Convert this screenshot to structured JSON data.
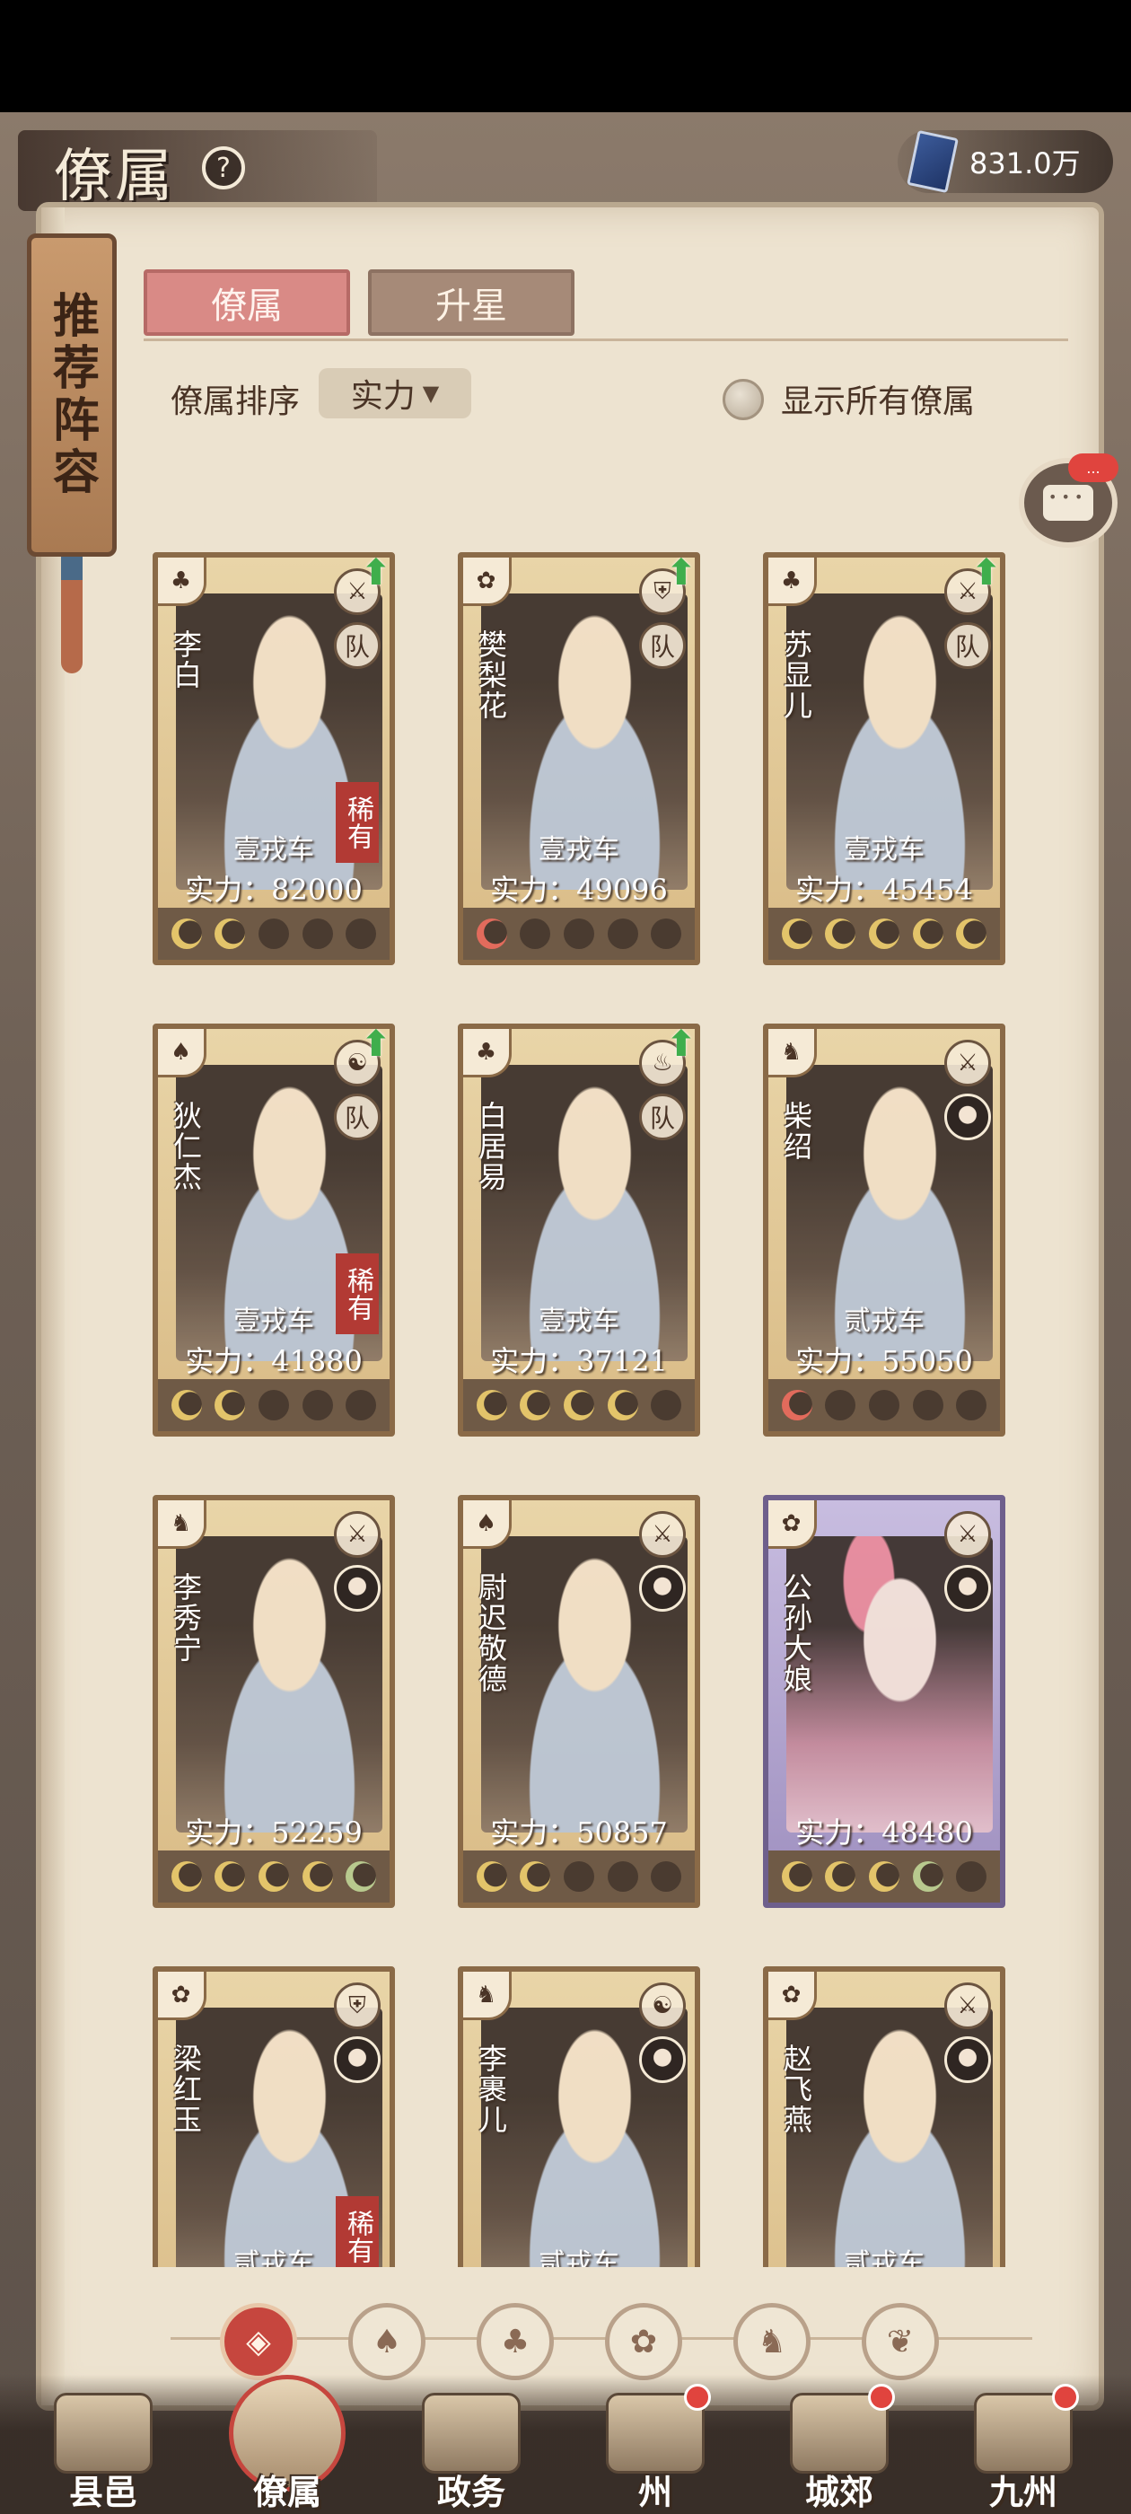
{
  "header": {
    "title": "僚属",
    "help_icon": "question-icon",
    "currency": {
      "icon": "book-token-icon",
      "value": "831.0万"
    }
  },
  "sidebar": {
    "recommend_label": "推荐阵容"
  },
  "tabs": [
    {
      "label": "僚属",
      "active": true
    },
    {
      "label": "升星",
      "active": false
    }
  ],
  "sort": {
    "label": "僚属排序",
    "selected": "实力",
    "show_all_label": "显示所有僚属",
    "show_all_checked": false
  },
  "chat": {
    "icon": "chat-icon",
    "badge": "..."
  },
  "cards": [
    {
      "name": "李白",
      "type_icon": "♣",
      "weapon": "⚔",
      "team": "队",
      "rare": "稀有",
      "rank": "壹戎车",
      "power": "实力：82000",
      "stars": [
        "gold",
        "gold",
        "empty",
        "empty",
        "empty"
      ],
      "upgradable": true
    },
    {
      "name": "樊梨花",
      "type_icon": "✿",
      "weapon": "⛨",
      "team": "队",
      "rare": "",
      "rank": "壹戎车",
      "power": "实力：49096",
      "stars": [
        "red",
        "empty",
        "empty",
        "empty",
        "empty"
      ],
      "upgradable": true
    },
    {
      "name": "苏显儿",
      "type_icon": "♣",
      "weapon": "⚔",
      "team": "队",
      "rare": "",
      "rank": "壹戎车",
      "power": "实力：45454",
      "stars": [
        "gold",
        "gold",
        "gold",
        "gold",
        "gold"
      ],
      "upgradable": true
    },
    {
      "name": "狄仁杰",
      "type_icon": "♠",
      "weapon": "☯",
      "team": "队",
      "rare": "稀有",
      "rank": "壹戎车",
      "power": "实力：41880",
      "stars": [
        "gold",
        "gold",
        "empty",
        "empty",
        "empty"
      ],
      "upgradable": true
    },
    {
      "name": "白居易",
      "type_icon": "♣",
      "weapon": "♨",
      "team": "队",
      "rare": "",
      "rank": "壹戎车",
      "power": "实力：37121",
      "stars": [
        "gold",
        "gold",
        "gold",
        "gold",
        "empty"
      ],
      "upgradable": true
    },
    {
      "name": "柴绍",
      "type_icon": "♞",
      "weapon": "⚔",
      "team": "",
      "rare": "",
      "rank": "贰戎车",
      "power": "实力：55050",
      "stars": [
        "red",
        "empty",
        "empty",
        "empty",
        "empty"
      ],
      "upgradable": false
    },
    {
      "name": "李秀宁",
      "type_icon": "♞",
      "weapon": "⚔",
      "team": "",
      "rare": "",
      "rank": "",
      "power": "实力：52259",
      "stars": [
        "gold",
        "gold",
        "gold",
        "gold",
        "green"
      ],
      "upgradable": false
    },
    {
      "name": "尉迟敬德",
      "type_icon": "♠",
      "weapon": "⚔",
      "team": "",
      "rare": "",
      "rank": "",
      "power": "实力：50857",
      "stars": [
        "gold",
        "gold",
        "empty",
        "empty",
        "empty"
      ],
      "upgradable": false
    },
    {
      "name": "公孙大娘",
      "type_icon": "✿",
      "weapon": "⚔",
      "team": "",
      "rare": "",
      "rank": "",
      "power": "实力：48480",
      "stars": [
        "gold",
        "gold",
        "gold",
        "green",
        "empty"
      ],
      "upgradable": false,
      "epic": true
    },
    {
      "name": "梁红玉",
      "type_icon": "✿",
      "weapon": "⛨",
      "team": "",
      "rare": "稀有",
      "rank": "贰戎车",
      "power": "",
      "stars": [],
      "upgradable": false
    },
    {
      "name": "李裹儿",
      "type_icon": "♞",
      "weapon": "☯",
      "team": "",
      "rare": "",
      "rank": "贰戎车",
      "power": "",
      "stars": [],
      "upgradable": false
    },
    {
      "name": "赵飞燕",
      "type_icon": "✿",
      "weapon": "⚔",
      "team": "",
      "rare": "",
      "rank": "贰戎车",
      "power": "",
      "stars": [],
      "upgradable": false
    }
  ],
  "filters": [
    {
      "icon": "all-filter-icon",
      "glyph": "◈",
      "active": true
    },
    {
      "icon": "helmet-filter-icon",
      "glyph": "♠",
      "active": false
    },
    {
      "icon": "gourd-filter-icon",
      "glyph": "♣",
      "active": false
    },
    {
      "icon": "fan-filter-icon",
      "glyph": "✿",
      "active": false
    },
    {
      "icon": "horse-filter-icon",
      "glyph": "♞",
      "active": false
    },
    {
      "icon": "leaf-filter-icon",
      "glyph": "❦",
      "active": false
    }
  ],
  "bottom_nav": [
    {
      "label": "县邑",
      "icon": "county-icon",
      "active": false,
      "dot": false
    },
    {
      "label": "僚属",
      "icon": "subordinates-icon",
      "active": true,
      "dot": false
    },
    {
      "label": "政务",
      "icon": "affairs-icon",
      "active": false,
      "dot": false
    },
    {
      "label": "州",
      "icon": "prefecture-icon",
      "active": false,
      "dot": true
    },
    {
      "label": "城郊",
      "icon": "suburbs-icon",
      "active": false,
      "dot": true
    },
    {
      "label": "九州",
      "icon": "world-map-icon",
      "active": false,
      "dot": true
    }
  ]
}
